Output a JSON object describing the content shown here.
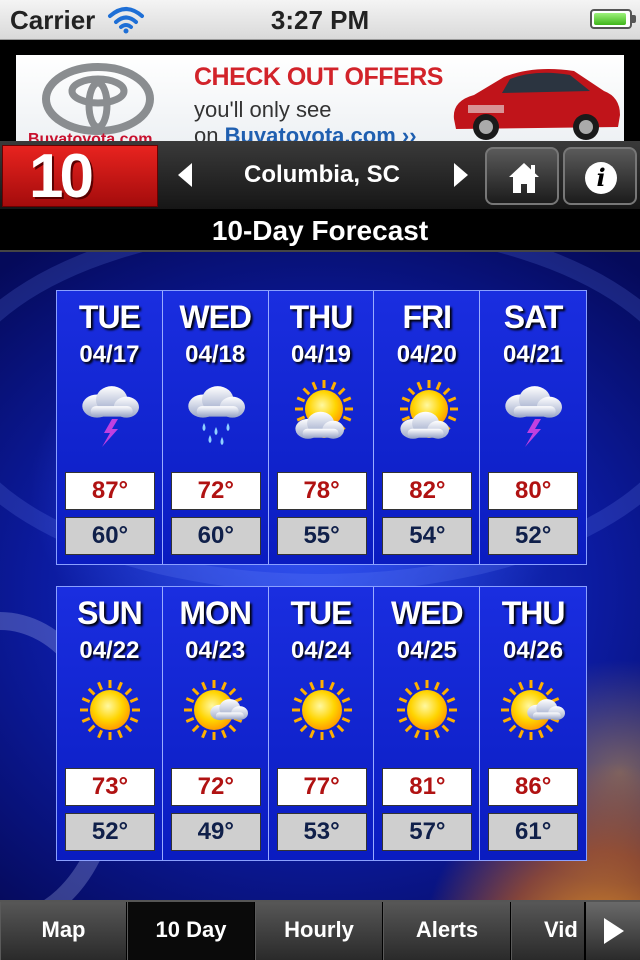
{
  "status_bar": {
    "carrier": "Carrier",
    "time": "3:27 PM",
    "battery_level": 0.95
  },
  "ad": {
    "headline": "CHECK OUT OFFERS",
    "line2": "you'll only see",
    "line3_prefix": "on",
    "line3_link": "Buyatoyota.com ››",
    "site_small": "Buyatoyota.com"
  },
  "header": {
    "station": "10",
    "location": "Columbia, SC"
  },
  "title": "10-Day Forecast",
  "forecast": [
    {
      "day": "TUE",
      "date": "04/17",
      "icon": "thunderstorm-icon",
      "hi": "87°",
      "lo": "60°"
    },
    {
      "day": "WED",
      "date": "04/18",
      "icon": "rain-icon",
      "hi": "72°",
      "lo": "60°"
    },
    {
      "day": "THU",
      "date": "04/19",
      "icon": "partly-cloudy-icon",
      "hi": "78°",
      "lo": "55°"
    },
    {
      "day": "FRI",
      "date": "04/20",
      "icon": "partly-cloudy-icon",
      "hi": "82°",
      "lo": "54°"
    },
    {
      "day": "SAT",
      "date": "04/21",
      "icon": "thunderstorm-icon",
      "hi": "80°",
      "lo": "52°"
    },
    {
      "day": "SUN",
      "date": "04/22",
      "icon": "sunny-icon",
      "hi": "73°",
      "lo": "52°"
    },
    {
      "day": "MON",
      "date": "04/23",
      "icon": "partly-sunny-icon",
      "hi": "72°",
      "lo": "49°"
    },
    {
      "day": "TUE",
      "date": "04/24",
      "icon": "sunny-icon",
      "hi": "77°",
      "lo": "53°"
    },
    {
      "day": "WED",
      "date": "04/25",
      "icon": "sunny-icon",
      "hi": "81°",
      "lo": "57°"
    },
    {
      "day": "THU",
      "date": "04/26",
      "icon": "partly-sunny-icon",
      "hi": "86°",
      "lo": "61°"
    }
  ],
  "tabs": [
    {
      "label": "Map",
      "active": false
    },
    {
      "label": "10 Day",
      "active": true
    },
    {
      "label": "Hourly",
      "active": false
    },
    {
      "label": "Alerts",
      "active": false
    },
    {
      "label": "Vid",
      "active": false
    }
  ],
  "colors": {
    "hi_temp": "#b01212",
    "lo_temp": "#10204a",
    "card_blue": "#1a2ee0",
    "logo_red": "#e8231f"
  }
}
